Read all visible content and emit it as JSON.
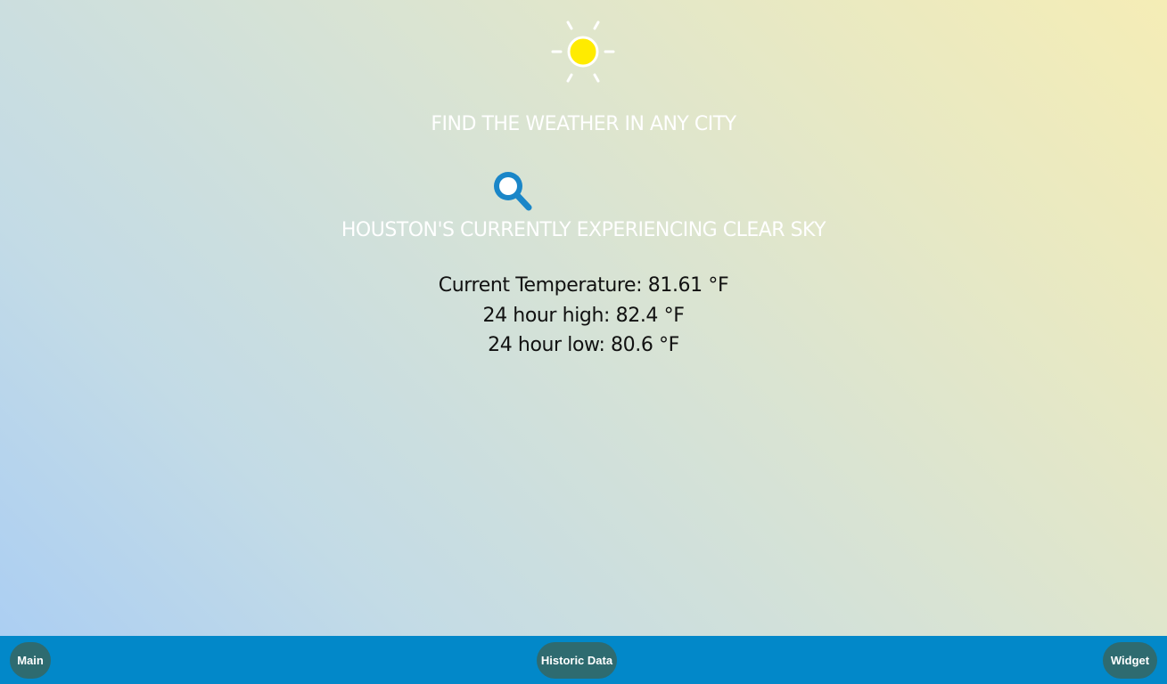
{
  "header": {
    "logo_icon": "sun-icon",
    "tagline": "FIND THE WEATHER IN ANY CITY"
  },
  "search": {
    "icon": "magnifying-glass-icon"
  },
  "weather": {
    "condition_text": "HOUSTON'S CURRENTLY EXPERIENCING CLEAR SKY",
    "current_temp": "Current Temperature: 81.61 °F",
    "high_24h": "24 hour high: 82.4 °F",
    "low_24h": "24 hour low: 80.6 °F"
  },
  "nav": {
    "main_label": "Main",
    "historic_label": "Historic Data",
    "widget_label": "Widget"
  },
  "colors": {
    "footer": "#0288c9",
    "nav_button": "#2e6b70",
    "sun": "#ffeb00",
    "search_icon": "#1a86c8"
  }
}
